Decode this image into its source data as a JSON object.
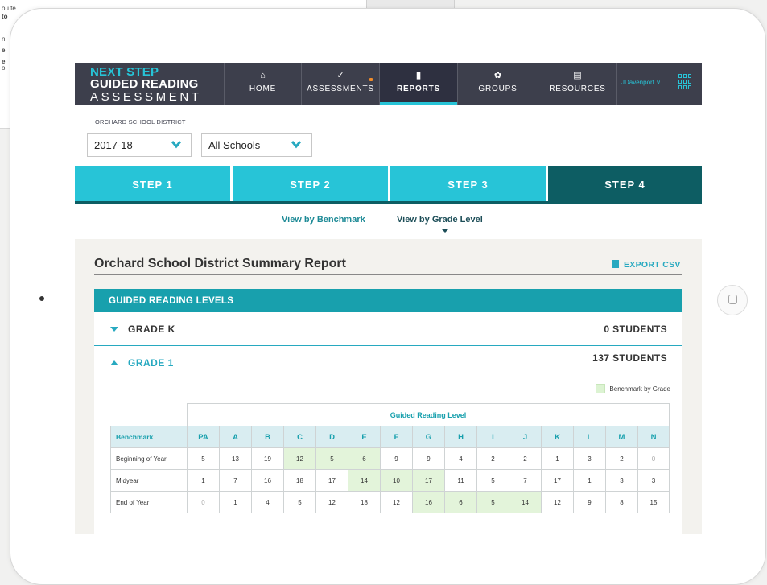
{
  "background": {
    "snippets": [
      "ou fe",
      "to",
      "n",
      "e",
      "e",
      "o"
    ]
  },
  "app": {
    "logo": {
      "line1": "NEXT STEP",
      "line2": "GUIDED READING",
      "line3": "ASSESSMENT"
    },
    "nav": [
      {
        "label": "HOME",
        "icon": "home-icon",
        "glyph": "⌂"
      },
      {
        "label": "ASSESSMENTS",
        "icon": "check-icon",
        "glyph": "✓"
      },
      {
        "label": "REPORTS",
        "icon": "bar-chart-icon",
        "glyph": "▮"
      },
      {
        "label": "GROUPS",
        "icon": "groups-icon",
        "glyph": "✿"
      },
      {
        "label": "RESOURCES",
        "icon": "document-icon",
        "glyph": "▤"
      }
    ],
    "user": {
      "name": "JDavenport",
      "caret": "∨"
    }
  },
  "filters": {
    "district": "ORCHARD SCHOOL DISTRICT",
    "year": "2017-18",
    "school": "All Schools"
  },
  "steps": [
    "STEP 1",
    "STEP 2",
    "STEP 3",
    "STEP 4"
  ],
  "views": {
    "benchmark": "View by Benchmark",
    "grade_level": "View by Grade Level"
  },
  "report": {
    "title": "Orchard School District Summary Report",
    "export": "EXPORT CSV",
    "section": "GUIDED READING LEVELS",
    "grades": [
      {
        "label": "GRADE K",
        "count": "0 STUDENTS"
      },
      {
        "label": "GRADE 1",
        "count": "137 STUDENTS"
      }
    ],
    "legend": "Benchmark by Grade",
    "table": {
      "caption": "Guided Reading Level",
      "corner": "Benchmark",
      "levels": [
        "PA",
        "A",
        "B",
        "C",
        "D",
        "E",
        "F",
        "G",
        "H",
        "I",
        "J",
        "K",
        "L",
        "M",
        "N"
      ],
      "rows": [
        {
          "label": "Beginning of Year",
          "values": [
            "5",
            "13",
            "19",
            "12",
            "5",
            "6",
            "9",
            "9",
            "4",
            "2",
            "2",
            "1",
            "3",
            "2",
            "0"
          ]
        },
        {
          "label": "Midyear",
          "values": [
            "1",
            "7",
            "16",
            "18",
            "17",
            "14",
            "10",
            "17",
            "11",
            "5",
            "7",
            "17",
            "1",
            "3",
            "3"
          ]
        },
        {
          "label": "End of Year",
          "values": [
            "0",
            "1",
            "4",
            "5",
            "12",
            "18",
            "12",
            "16",
            "6",
            "5",
            "14",
            "12",
            "9",
            "8",
            "15"
          ]
        }
      ]
    }
  },
  "colors": {
    "nav_bg": "#3d3f4c",
    "accent": "#27c4d7",
    "step_active": "#0d5d63",
    "section_header": "#18a0ad",
    "benchmark_highlight": "#e3f4da"
  }
}
